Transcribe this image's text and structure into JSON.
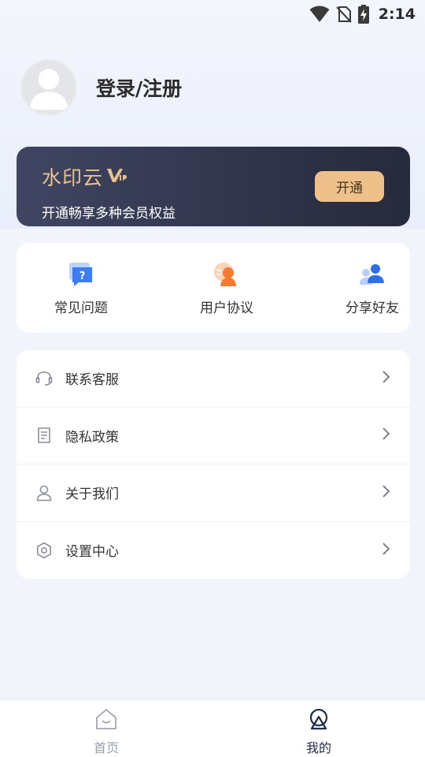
{
  "status_bar": {
    "time": "2:14",
    "icons": [
      "wifi-icon",
      "no-sim-icon",
      "battery-charging-icon"
    ]
  },
  "profile": {
    "avatar_icon": "user-avatar-icon",
    "login_text": "登录/注册"
  },
  "vip_card": {
    "title": "水印云",
    "badge_icon": "vip-badge-icon",
    "subtitle": "开通畅享多种会员权益",
    "button_label": "开通",
    "accent_color": "#efc18a"
  },
  "shortcuts": [
    {
      "label": "常见问题",
      "icon": "faq-icon"
    },
    {
      "label": "用户协议",
      "icon": "agreement-icon"
    },
    {
      "label": "分享好友",
      "icon": "share-friends-icon"
    }
  ],
  "menu": [
    {
      "label": "联系客服",
      "icon": "headset-icon"
    },
    {
      "label": "隐私政策",
      "icon": "document-icon"
    },
    {
      "label": "关于我们",
      "icon": "person-icon"
    },
    {
      "label": "设置中心",
      "icon": "gear-icon"
    }
  ],
  "tab_bar": {
    "tabs": [
      {
        "label": "首页",
        "icon": "home-icon",
        "active": false
      },
      {
        "label": "我的",
        "icon": "profile-icon",
        "active": true
      }
    ]
  }
}
